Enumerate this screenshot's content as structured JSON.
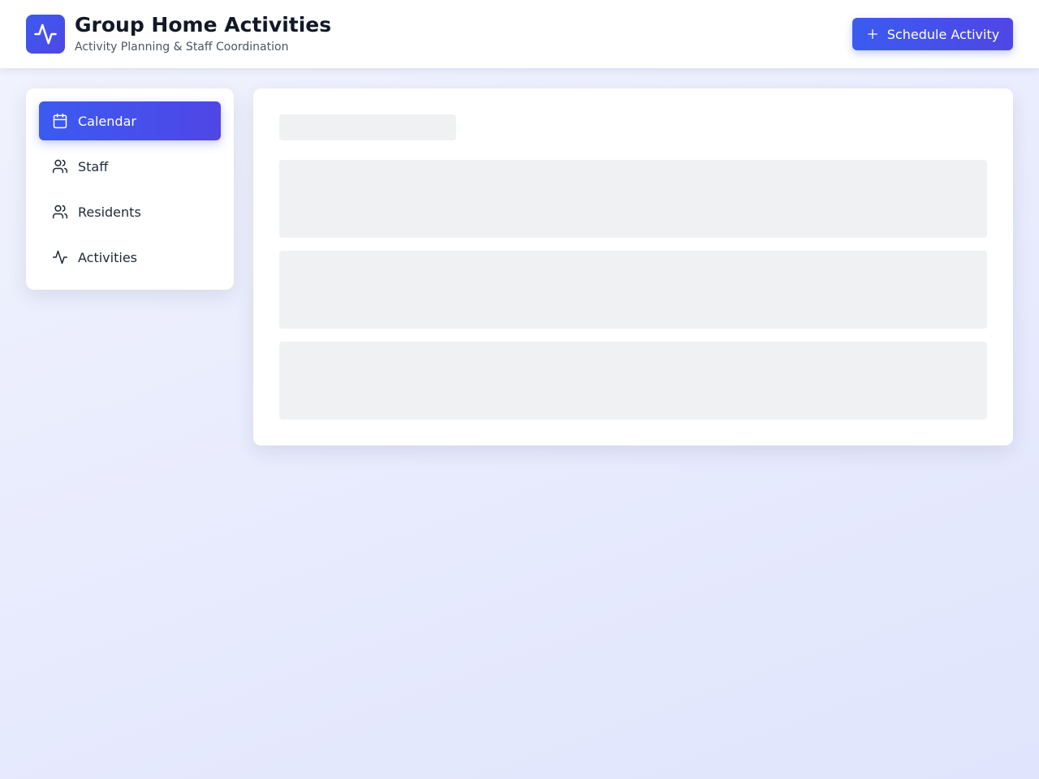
{
  "header": {
    "logo_icon": "activity-icon",
    "title": "Group Home Activities",
    "subtitle": "Activity Planning & Staff Coordination",
    "primary_button": {
      "icon": "plus-icon",
      "label": "Schedule Activity"
    }
  },
  "sidebar": {
    "items": [
      {
        "label": "Calendar",
        "icon": "calendar-icon",
        "active": true
      },
      {
        "label": "Staff",
        "icon": "users-icon",
        "active": false
      },
      {
        "label": "Residents",
        "icon": "users-icon",
        "active": false
      },
      {
        "label": "Activities",
        "icon": "activity-icon",
        "active": false
      }
    ]
  },
  "main": {
    "state": "loading",
    "skeleton_blocks": 3
  },
  "colors": {
    "accent": "#3b5bf0",
    "accent_end": "#4f46e5",
    "skeleton": "#f0f1f3",
    "text_primary": "#111827",
    "text_secondary": "#4b5563"
  }
}
